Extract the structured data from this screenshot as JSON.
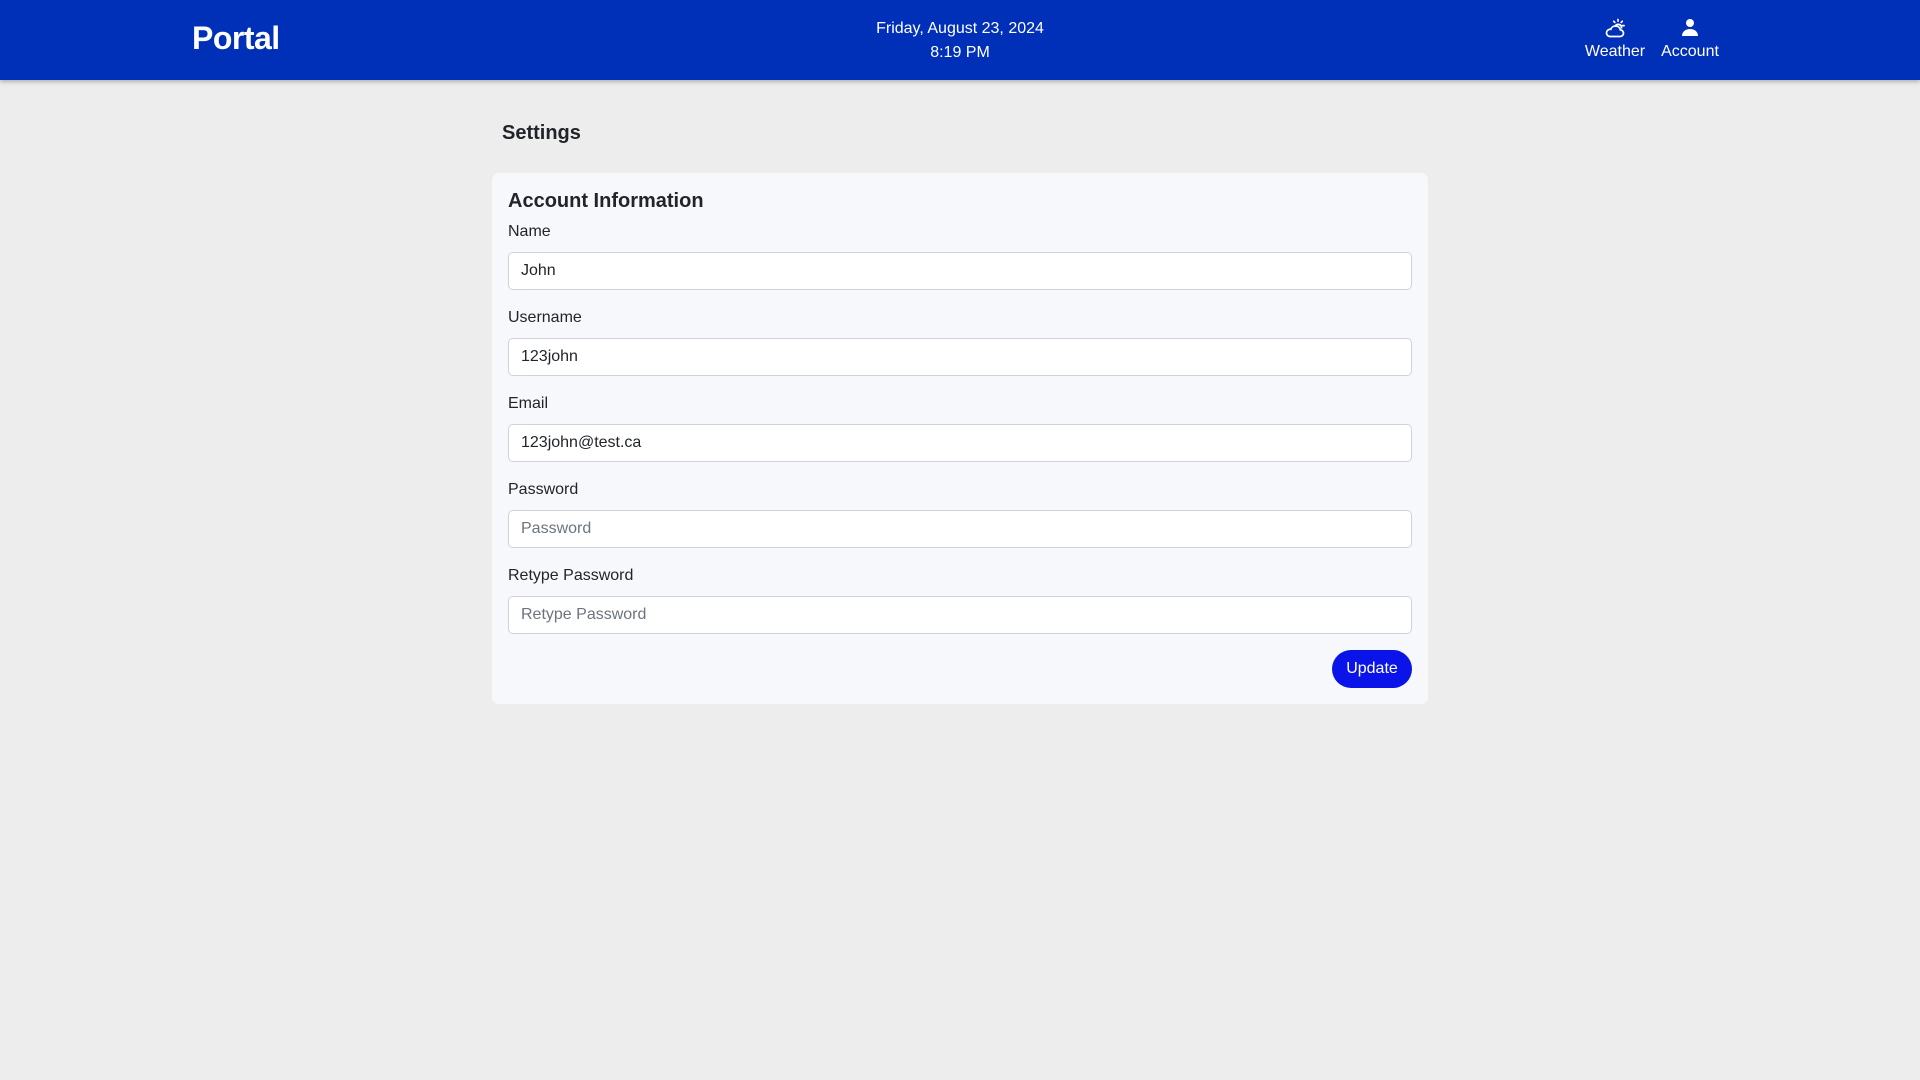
{
  "header": {
    "brand": "Portal",
    "date": "Friday, August 23, 2024",
    "time": "8:19 PM",
    "nav": {
      "weather": {
        "label": "Weather",
        "icon": "weather-partly-cloudy-icon"
      },
      "account": {
        "label": "Account",
        "icon": "person-icon"
      }
    },
    "colors": {
      "background": "#0030b8",
      "text": "#ffffff"
    }
  },
  "page": {
    "title": "Settings",
    "background": "#ededed"
  },
  "account_info": {
    "title": "Account Information",
    "fields": {
      "name": {
        "label": "Name",
        "value": "John",
        "placeholder": ""
      },
      "username": {
        "label": "Username",
        "value": "123john",
        "placeholder": ""
      },
      "email": {
        "label": "Email",
        "value": "123john@test.ca",
        "placeholder": ""
      },
      "password": {
        "label": "Password",
        "value": "",
        "placeholder": "Password"
      },
      "retype_password": {
        "label": "Retype Password",
        "value": "",
        "placeholder": "Retype Password"
      }
    },
    "update_button": {
      "label": "Update",
      "color": "#0a14e8"
    }
  }
}
